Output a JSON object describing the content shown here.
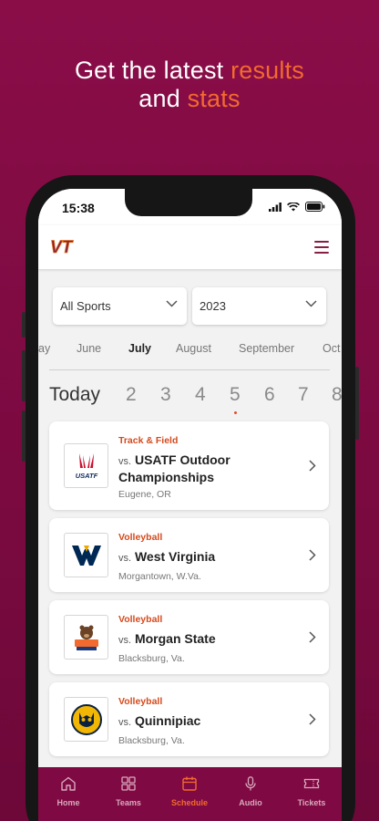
{
  "promo": {
    "line1_prefix": "Get the latest ",
    "line1_accent": "results",
    "line2_prefix": "and ",
    "line2_accent": "stats"
  },
  "status": {
    "time": "15:38"
  },
  "app": {
    "logo_text": "VT",
    "colors": {
      "maroon": "#861f41",
      "orange": "#e5751f"
    }
  },
  "filters": {
    "sport": "All Sports",
    "year": "2023"
  },
  "months": [
    "ay",
    "June",
    "July",
    "August",
    "September",
    "Oct"
  ],
  "selected_month": "July",
  "days": [
    "Today",
    "2",
    "3",
    "4",
    "5",
    "6",
    "7",
    "8"
  ],
  "selected_day": "5",
  "events": [
    {
      "sport": "Track & Field",
      "vs": "vs.",
      "opponent": "USATF Outdoor Championships",
      "location": "Eugene, OR",
      "logo": "usatf-logo"
    },
    {
      "sport": "Volleyball",
      "vs": "vs.",
      "opponent": "West Virginia",
      "location": "Morgantown, W.Va.",
      "logo": "west-virginia-logo"
    },
    {
      "sport": "Volleyball",
      "vs": "vs.",
      "opponent": "Morgan State",
      "location": "Blacksburg, Va.",
      "logo": "morgan-state-logo"
    },
    {
      "sport": "Volleyball",
      "vs": "vs.",
      "opponent": "Quinnipiac",
      "location": "Blacksburg, Va.",
      "logo": "quinnipiac-logo"
    }
  ],
  "tabs": [
    {
      "label": "Home",
      "icon": "home-icon"
    },
    {
      "label": "Teams",
      "icon": "teams-icon"
    },
    {
      "label": "Schedule",
      "icon": "calendar-icon"
    },
    {
      "label": "Audio",
      "icon": "microphone-icon"
    },
    {
      "label": "Tickets",
      "icon": "ticket-icon"
    }
  ],
  "active_tab": "Schedule"
}
